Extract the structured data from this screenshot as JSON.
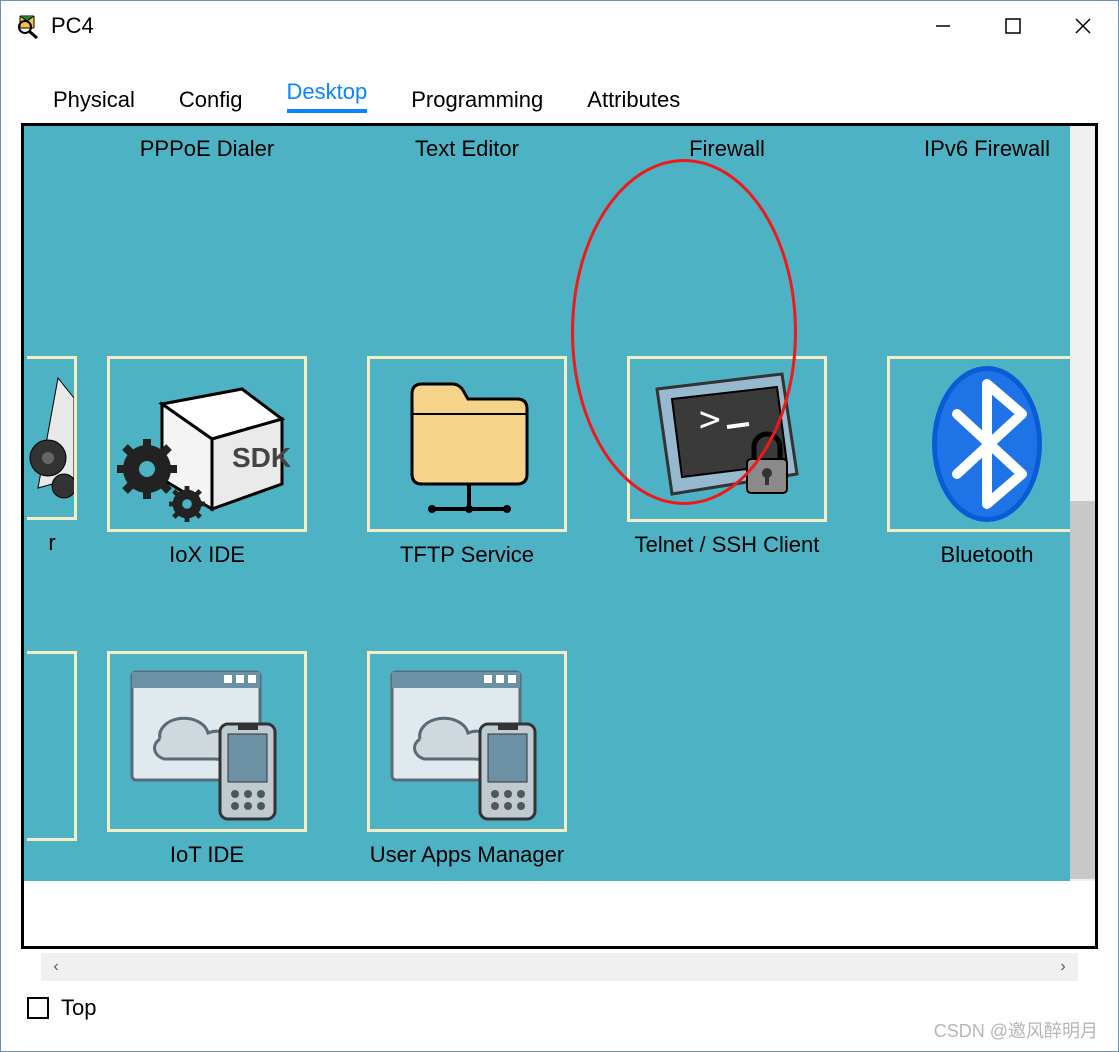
{
  "window": {
    "title": "PC4"
  },
  "tabs": [
    {
      "label": "Physical",
      "active": false
    },
    {
      "label": "Config",
      "active": false
    },
    {
      "label": "Desktop",
      "active": true
    },
    {
      "label": "Programming",
      "active": false
    },
    {
      "label": "Attributes",
      "active": false
    }
  ],
  "rows": {
    "row1": {
      "partial_label": "",
      "apps": [
        {
          "label": "PPPoE Dialer",
          "icon": "pppoe-dialer-icon"
        },
        {
          "label": "Text Editor",
          "icon": "text-editor-icon"
        },
        {
          "label": "Firewall",
          "icon": "firewall-icon"
        },
        {
          "label": "IPv6 Firewall",
          "icon": "ipv6-firewall-icon"
        }
      ]
    },
    "row2": {
      "partial_label": "r",
      "apps": [
        {
          "label": "IoX IDE",
          "icon": "iox-ide-icon"
        },
        {
          "label": "TFTP Service",
          "icon": "tftp-service-icon"
        },
        {
          "label": "Telnet / SSH Client",
          "icon": "telnet-ssh-icon",
          "highlighted": true
        },
        {
          "label": "Bluetooth",
          "icon": "bluetooth-icon"
        }
      ]
    },
    "row3": {
      "partial_label": "",
      "apps": [
        {
          "label": "IoT IDE",
          "icon": "iot-ide-icon"
        },
        {
          "label": "User Apps Manager",
          "icon": "user-apps-manager-icon"
        }
      ]
    }
  },
  "footer": {
    "top_label": "Top"
  },
  "watermark": "CSDN @邀风醉明月"
}
